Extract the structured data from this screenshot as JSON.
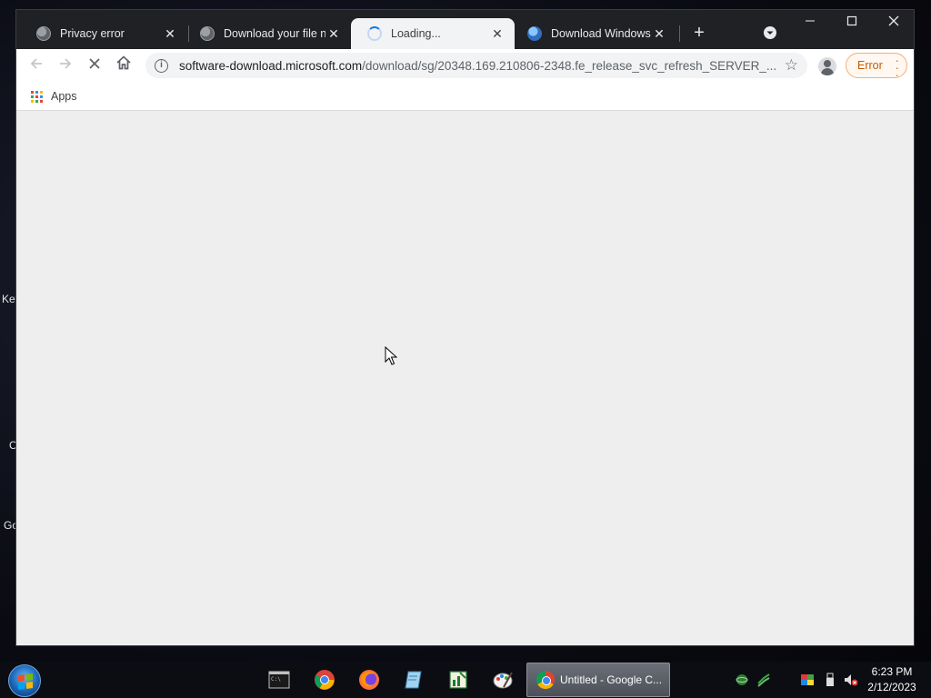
{
  "desktop": {
    "fragments": [
      "Key",
      "C",
      "Go"
    ]
  },
  "browser": {
    "tabs": [
      {
        "title": "Privacy error",
        "icon": "globe-icon"
      },
      {
        "title": "Download your file no",
        "icon": "globe-icon"
      },
      {
        "title": "Loading...",
        "icon": "loading-spinner-icon",
        "active": true
      },
      {
        "title": "Download Windows S",
        "icon": "windows-globe-icon"
      }
    ],
    "new_tab_label": "+",
    "url_host": "software-download.microsoft.com",
    "url_path": "/download/sg/20348.169.210806-2348.fe_release_svc_refresh_SERVER_...",
    "error_chip_label": "Error",
    "bookmarks": {
      "apps_label": "Apps"
    }
  },
  "taskbar": {
    "active_window_label": "Untitled - Google C...",
    "clock_time": "6:23 PM",
    "clock_date": "2/12/2023",
    "pinned_icons": [
      "cmd-icon",
      "chrome-icon",
      "firefox-icon",
      "notepad-icon",
      "spreadsheet-icon",
      "paint-icon"
    ]
  },
  "colors": {
    "chrome_dark": "#202124",
    "content_bg": "#eeeeee",
    "error_accent": "#c25b00"
  }
}
